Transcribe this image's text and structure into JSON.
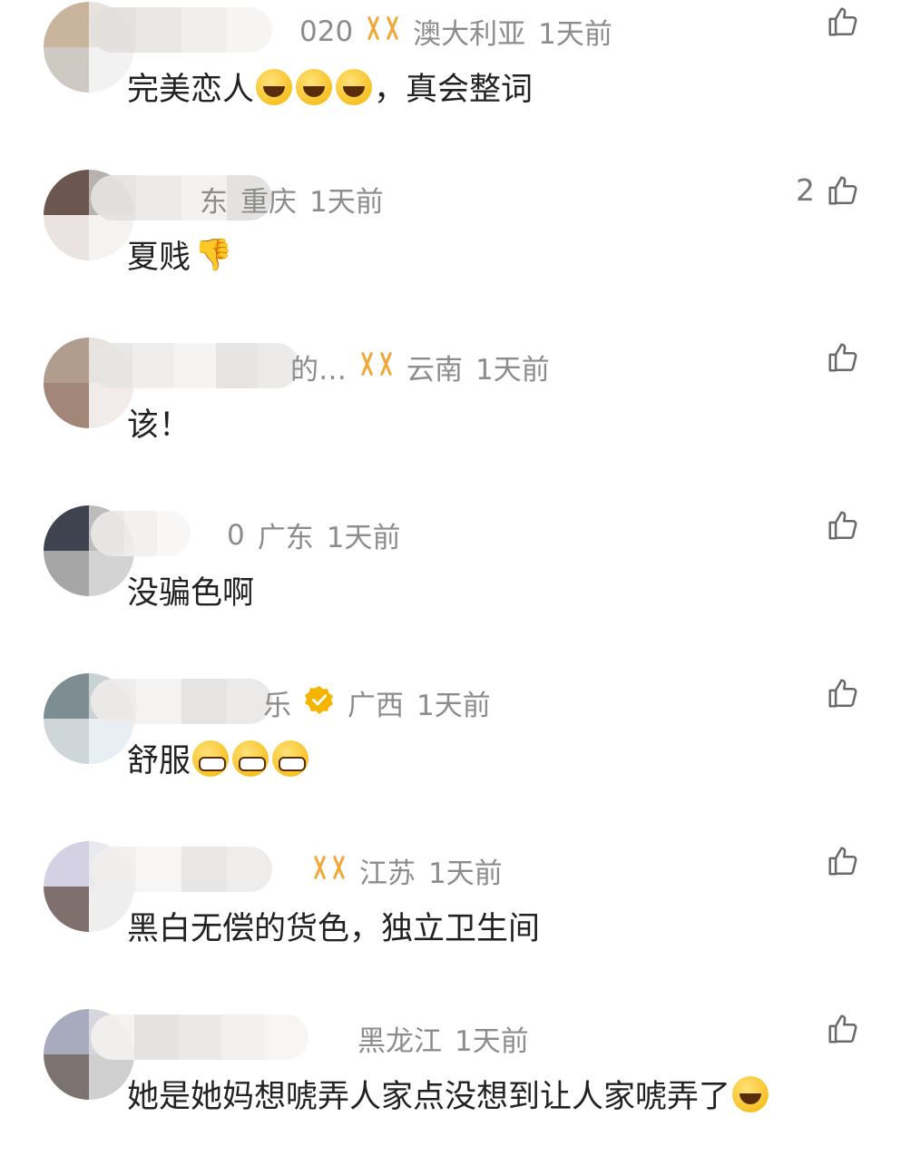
{
  "comments": [
    {
      "name_tail": "020",
      "location": "澳大利亚",
      "time": "1天前",
      "text": "完美恋人",
      "emoji_count": 3,
      "emoji": "laugh",
      "text_after": "，真会整词",
      "like_count": "",
      "badge": "vip"
    },
    {
      "name_tail": "东",
      "location": "重庆",
      "time": "1天前",
      "text": "夏贱",
      "emoji_count": 0,
      "emoji": "thumbdown",
      "text_after": "",
      "like_count": "2",
      "badge": ""
    },
    {
      "name_tail": "的…",
      "location": "云南",
      "time": "1天前",
      "text": "该！",
      "emoji_count": 0,
      "emoji": "",
      "text_after": "",
      "like_count": "",
      "badge": "vip"
    },
    {
      "name_tail": "0",
      "location": "广东",
      "time": "1天前",
      "text": "没骗色啊",
      "emoji_count": 0,
      "emoji": "",
      "text_after": "",
      "like_count": "",
      "badge": ""
    },
    {
      "name_tail": "乐",
      "location": "广西",
      "time": "1天前",
      "text": "舒服",
      "emoji_count": 3,
      "emoji": "grin",
      "text_after": "",
      "like_count": "",
      "badge": "verify"
    },
    {
      "name_tail": "",
      "location": "江苏",
      "time": "1天前",
      "text": "黑白无偿的货色，独立卫生间",
      "emoji_count": 0,
      "emoji": "",
      "text_after": "",
      "like_count": "",
      "badge": "vip"
    },
    {
      "name_tail": "",
      "location": "黑龙江",
      "time": "1天前",
      "text": "她是她妈想唬弄人家点没想到让人家唬弄了",
      "emoji_count": 1,
      "emoji": "laugh",
      "text_after": "",
      "like_count": "",
      "badge": ""
    }
  ],
  "colors": {
    "accent": "#f0a83a",
    "meta": "#8c8c8c",
    "text": "#222222"
  },
  "icons": {
    "like": "thumb-up-outline-icon",
    "vip": "vip-ribbon-icon",
    "verify": "verified-badge-icon"
  }
}
